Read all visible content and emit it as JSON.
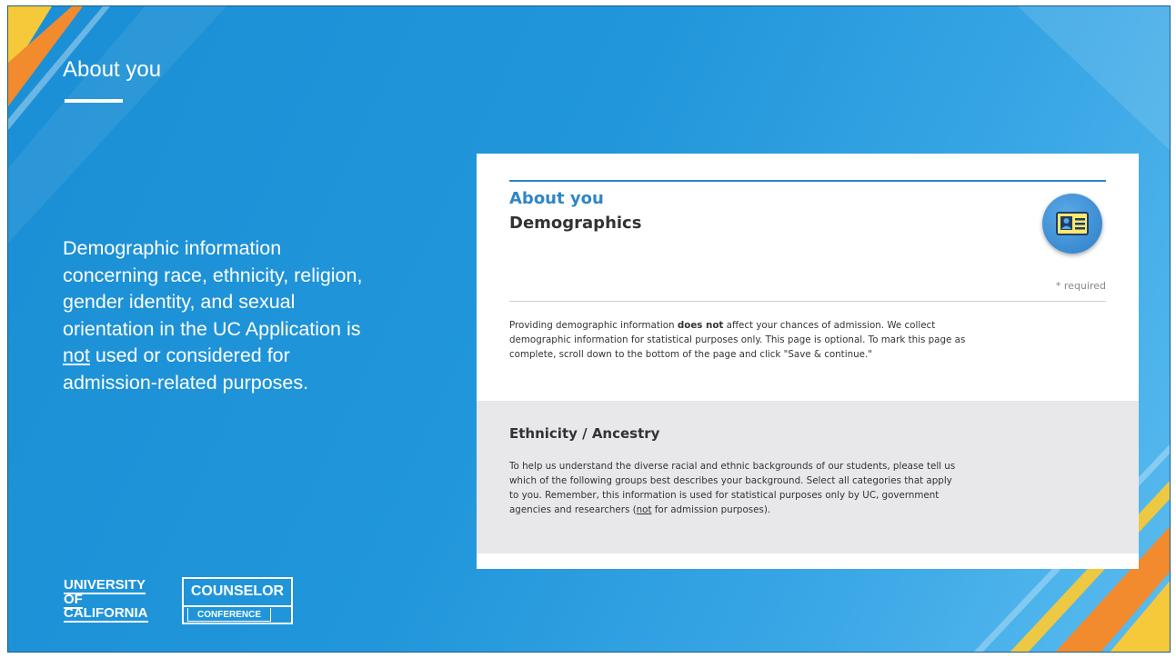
{
  "slide": {
    "title": "About  you",
    "body_lines_before_underline": "Demographic information concerning race, ethnicity, religion, gender identity, and sexual orientation in the UC Application is ",
    "body_underlined": "not",
    "body_after": " used or considered for admission-related purposes."
  },
  "card": {
    "heading": "About you",
    "subheading": "Demographics",
    "badge_icon": "id-card-icon",
    "required_note": "* required",
    "intro_pre": "Providing demographic information ",
    "intro_bold": "does not",
    "intro_post": " affect your chances of admission. We collect demographic information for statistical purposes only. This page is optional. To mark this page as complete, scroll down to the bottom of the page and click \"Save & continue.\"",
    "section_title": "Ethnicity / Ancestry",
    "section_pre": "To help us understand the diverse racial and ethnic backgrounds of our students, please tell us which of the following groups best describes your background. Select all categories that apply to you. Remember, this information is used for statistical purposes only by UC, government agencies and researchers (",
    "section_underlined": "not",
    "section_post": " for admission purposes)."
  },
  "logos": {
    "uc_line1": "UNIVERSITY",
    "uc_line2": "OF",
    "uc_line3": "CALIFORNIA",
    "cc_big": "COUNSELOR",
    "cc_small": "CONFERENCE"
  },
  "colors": {
    "background": "#2196da",
    "accent_orange": "#f28a2e",
    "accent_yellow": "#f5c93a",
    "card_blue": "#2f86c6"
  }
}
